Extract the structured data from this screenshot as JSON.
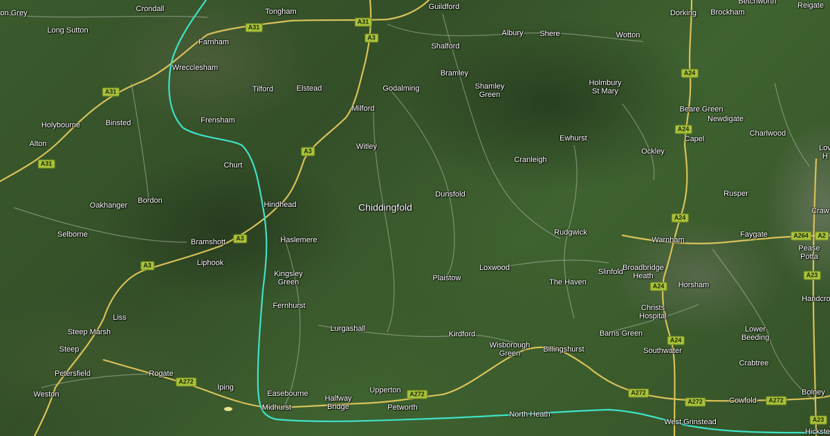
{
  "map": {
    "route_color": "#3fe3c8",
    "road_color": "#d9c25a",
    "minor_road_color": "#cfd3c7",
    "place_labels": [
      {
        "text": "on Grey"
      },
      {
        "text": "Crondall"
      },
      {
        "text": "Tongham"
      },
      {
        "text": "Guildford"
      },
      {
        "text": "Dorking"
      },
      {
        "text": "Brockham"
      },
      {
        "text": "Betchworth"
      },
      {
        "text": "Reigate"
      },
      {
        "text": "Long Sutton"
      },
      {
        "text": "Farnham"
      },
      {
        "text": "Albury"
      },
      {
        "text": "Shere"
      },
      {
        "text": "Wotton"
      },
      {
        "text": "Shalford"
      },
      {
        "text": "Wrecclesham"
      },
      {
        "text": "Bramley"
      },
      {
        "text": "Tilford"
      },
      {
        "text": "Elstead"
      },
      {
        "text": "Godalming"
      },
      {
        "text": "Shamley\nGreen"
      },
      {
        "text": "Holmbury\nSt Mary"
      },
      {
        "text": "Holybourne"
      },
      {
        "text": "Binsted"
      },
      {
        "text": "Milford"
      },
      {
        "text": "Beare Green"
      },
      {
        "text": "Frensham"
      },
      {
        "text": "Newdigate"
      },
      {
        "text": "Charlwood"
      },
      {
        "text": "Alton"
      },
      {
        "text": "Ewhurst"
      },
      {
        "text": "Capel"
      },
      {
        "text": "Witley"
      },
      {
        "text": "Ockley"
      },
      {
        "text": "Lov"
      },
      {
        "text": "H"
      },
      {
        "text": "Churt"
      },
      {
        "text": "Cranleigh"
      },
      {
        "text": "Dunsfold"
      },
      {
        "text": "Rusper"
      },
      {
        "text": "Oakhanger"
      },
      {
        "text": "Bordon"
      },
      {
        "text": "Hindhead"
      },
      {
        "text": "Chiddingfold"
      },
      {
        "text": "Craw"
      },
      {
        "text": "Selborne"
      },
      {
        "text": "Rudgwick"
      },
      {
        "text": "Faygate"
      },
      {
        "text": "Bramshott"
      },
      {
        "text": "Haslemere"
      },
      {
        "text": "Warnham"
      },
      {
        "text": "Liphook"
      },
      {
        "text": "Pease Potta"
      },
      {
        "text": "Loxwood"
      },
      {
        "text": "Kingsley\nGreen"
      },
      {
        "text": "Slinfold"
      },
      {
        "text": "Broadbridge\nHeath"
      },
      {
        "text": "Plaistow"
      },
      {
        "text": "The Haven"
      },
      {
        "text": "Horsham"
      },
      {
        "text": "Handcro"
      },
      {
        "text": "Fernhurst"
      },
      {
        "text": "Christs\nHospital"
      },
      {
        "text": "Liss"
      },
      {
        "text": "Lurgashall"
      },
      {
        "text": "Steep Marsh"
      },
      {
        "text": "Kirdford"
      },
      {
        "text": "Barns Green"
      },
      {
        "text": "Lower\nBeeding"
      },
      {
        "text": "Wisborough\nGreen"
      },
      {
        "text": "Billingshurst"
      },
      {
        "text": "Steep"
      },
      {
        "text": "Southwater"
      },
      {
        "text": "Crabtree"
      },
      {
        "text": "Petersfield"
      },
      {
        "text": "Rogate"
      },
      {
        "text": "Iping"
      },
      {
        "text": "Upperton"
      },
      {
        "text": "Bolney"
      },
      {
        "text": "Weston"
      },
      {
        "text": "Easebourne"
      },
      {
        "text": "Halfway\nBridge"
      },
      {
        "text": "Cowfold"
      },
      {
        "text": "Midhurst"
      },
      {
        "text": "Petworth"
      },
      {
        "text": "North Heath"
      },
      {
        "text": "West Grinstead"
      },
      {
        "text": "Hickste"
      }
    ],
    "road_labels": [
      {
        "text": "A31"
      },
      {
        "text": "A31"
      },
      {
        "text": "A3"
      },
      {
        "text": "A31"
      },
      {
        "text": "A31"
      },
      {
        "text": "A3"
      },
      {
        "text": "A3"
      },
      {
        "text": "A3"
      },
      {
        "text": "A24"
      },
      {
        "text": "A24"
      },
      {
        "text": "A24"
      },
      {
        "text": "A264"
      },
      {
        "text": "A2"
      },
      {
        "text": "A23"
      },
      {
        "text": "A24"
      },
      {
        "text": "A24"
      },
      {
        "text": "A272"
      },
      {
        "text": "A272"
      },
      {
        "text": "A272"
      },
      {
        "text": "A272"
      },
      {
        "text": "A272"
      },
      {
        "text": "A23"
      }
    ]
  }
}
